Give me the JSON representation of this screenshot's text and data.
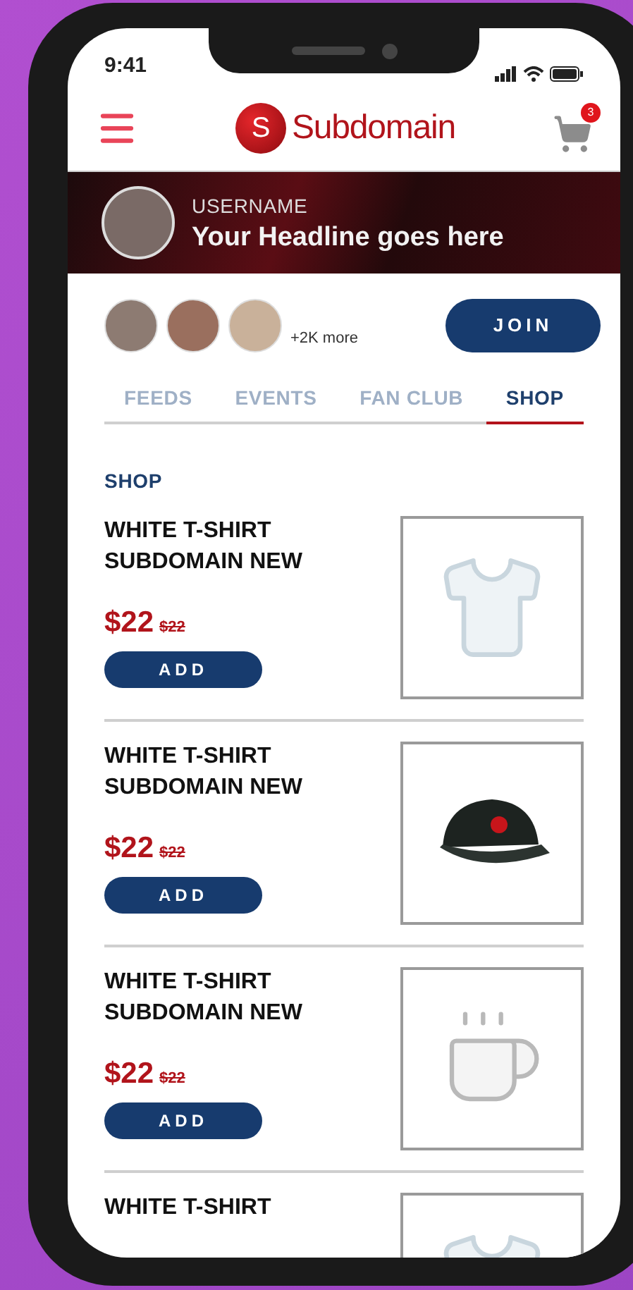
{
  "status_bar": {
    "time": "9:41"
  },
  "header": {
    "logo_letter": "S",
    "brand": "Subdomain",
    "cart_count": "3"
  },
  "profile": {
    "username": "USERNAME",
    "headline": "Your Headline goes here"
  },
  "members": {
    "more": "+2K more",
    "join": "JOIN"
  },
  "tabs": [
    {
      "label": "FEEDS",
      "selected": false
    },
    {
      "label": "EVENTS",
      "selected": false
    },
    {
      "label": "FAN CLUB",
      "selected": false
    },
    {
      "label": "SHOP",
      "selected": true
    }
  ],
  "section_title": "SHOP",
  "products": [
    {
      "kind": "tshirt",
      "name_lines": [
        "WHITE T-SHIRT",
        "SUBDOMAIN NEW"
      ],
      "price": "$22",
      "old_price": "$22",
      "button": "ADD"
    },
    {
      "kind": "cap",
      "name_lines": [
        "WHITE T-SHIRT",
        "SUBDOMAIN NEW"
      ],
      "price": "$22",
      "old_price": "$22",
      "button": "ADD"
    },
    {
      "kind": "mug",
      "name_lines": [
        "WHITE T-SHIRT",
        "SUBDOMAIN NEW"
      ],
      "price": "$22",
      "old_price": "$22",
      "button": "ADD"
    },
    {
      "kind": "tshirt",
      "name_lines": [
        "WHITE T-SHIRT"
      ]
    }
  ]
}
